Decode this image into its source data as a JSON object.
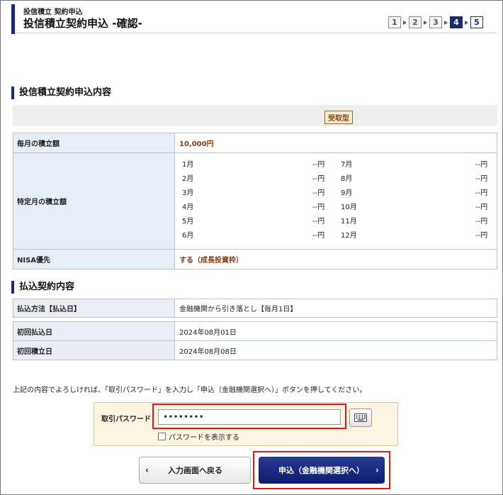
{
  "header": {
    "breadcrumb": "投信積立 契約申込",
    "title": "投信積立契約申込 -確認-",
    "steps": [
      "1",
      "2",
      "3",
      "4",
      "5"
    ],
    "active_step": "4"
  },
  "contract": {
    "heading": "投信積立契約申込内容",
    "badge": "受取型",
    "monthly_label": "毎月の積立額",
    "monthly_value": "10,000円",
    "special_label": "特定月の積立額",
    "months_left": [
      {
        "m": "1月",
        "v": "--円"
      },
      {
        "m": "2月",
        "v": "--円"
      },
      {
        "m": "3月",
        "v": "--円"
      },
      {
        "m": "4月",
        "v": "--円"
      },
      {
        "m": "5月",
        "v": "--円"
      },
      {
        "m": "6月",
        "v": "--円"
      }
    ],
    "months_right": [
      {
        "m": "7月",
        "v": "--円"
      },
      {
        "m": "8月",
        "v": "--円"
      },
      {
        "m": "9月",
        "v": "--円"
      },
      {
        "m": "10月",
        "v": "--円"
      },
      {
        "m": "11月",
        "v": "--円"
      },
      {
        "m": "12月",
        "v": "--円"
      }
    ],
    "nisa_label": "NISA優先",
    "nisa_value": "する（成長投資枠）"
  },
  "payment": {
    "heading": "払込契約内容",
    "method_label": "払込方法【払込日】",
    "method_value": "金融機関から引き落とし【毎月1日】",
    "first_pay_label": "初回払込日",
    "first_pay_value": "2024年08月01日",
    "first_invest_label": "初回積立日",
    "first_invest_value": "2024年08月08日"
  },
  "note": "上記の内容でよろしければ、「取引パスワード」を入力し「申込（金融機関選択へ）」ボタンを押してください。",
  "password": {
    "label": "取引パスワード",
    "value": "••••••••",
    "show_label": "パスワードを表示する"
  },
  "buttons": {
    "back": "入力画面へ戻る",
    "submit": "申込（金融機関選択へ）"
  },
  "colors": {
    "brand": "#1a2a78",
    "highlight": "#e01818",
    "amount": "#8a3a10"
  }
}
